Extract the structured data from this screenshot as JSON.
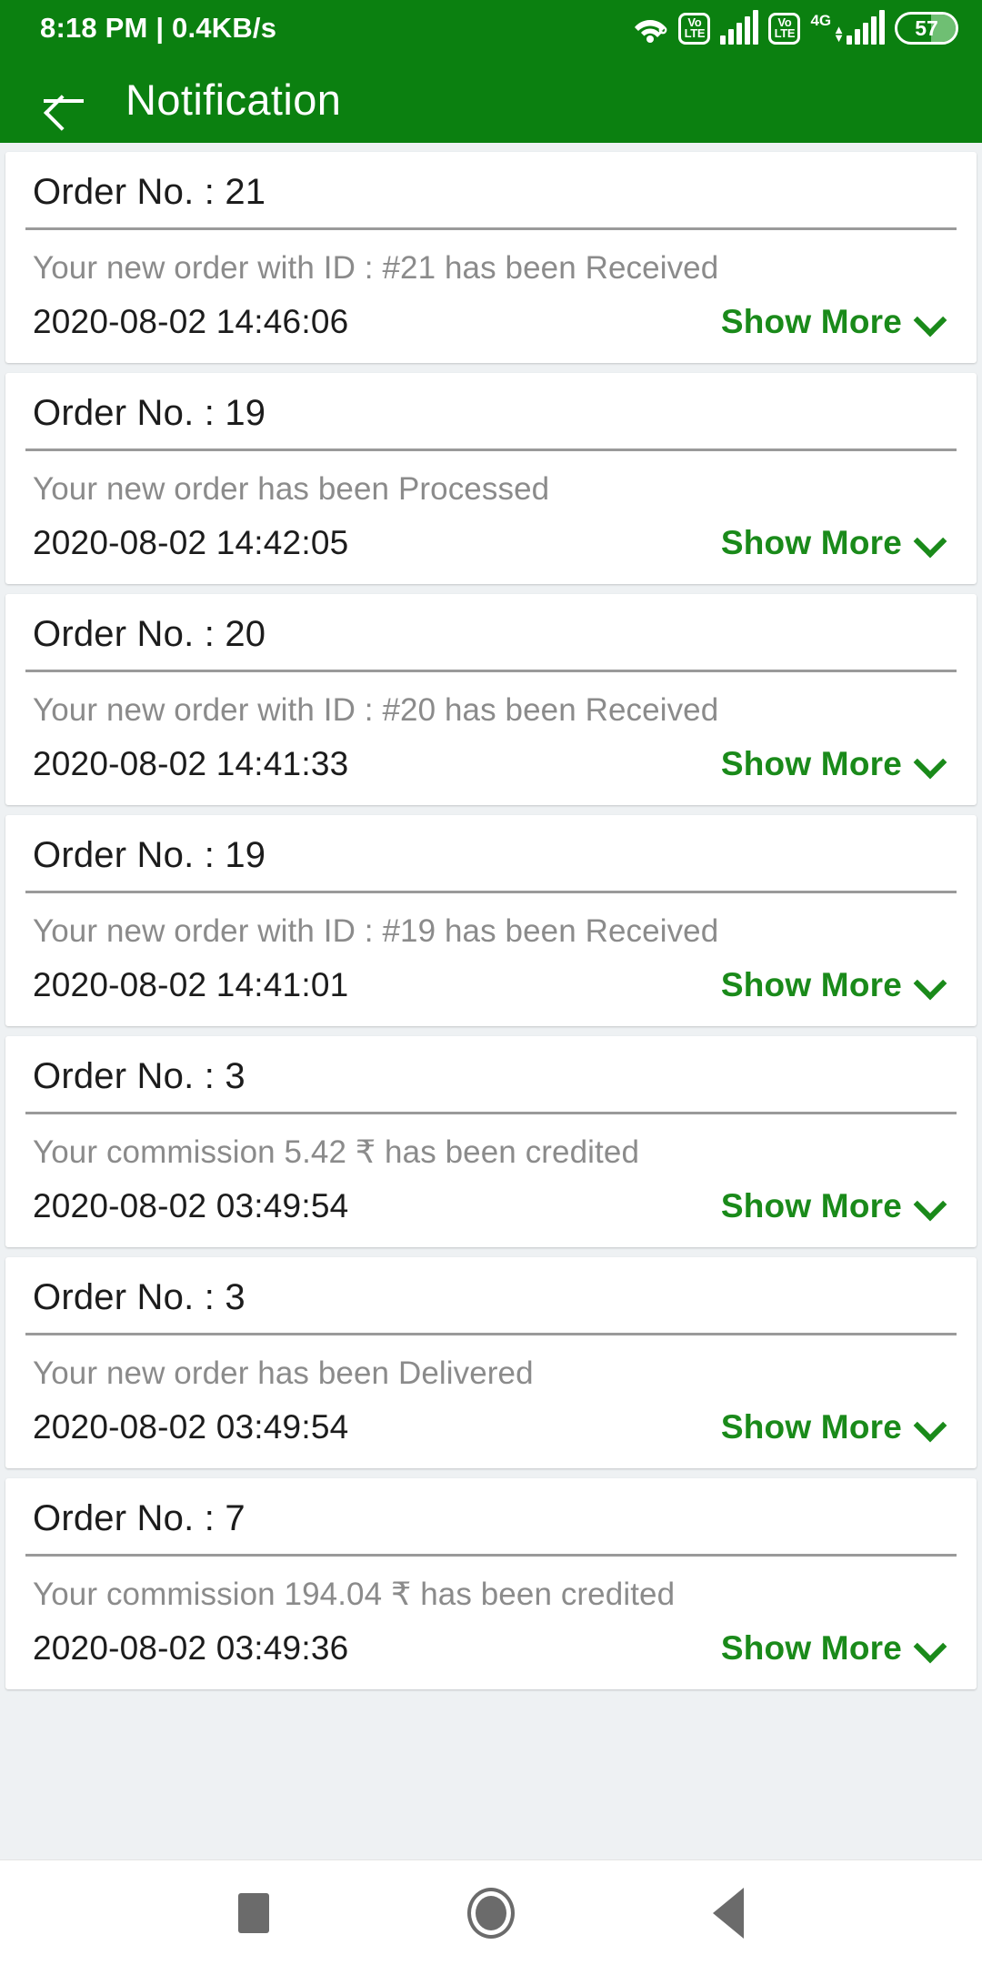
{
  "status_bar": {
    "time_and_speed": "8:18 PM | 0.4KB/s",
    "wifi_icon": "wifi-icon",
    "volte_1": {
      "top": "Vo",
      "bottom": "LTE"
    },
    "volte_2": {
      "top": "Vo",
      "bottom": "LTE"
    },
    "network_type": "4G",
    "battery_level": "57"
  },
  "app_bar": {
    "back_icon": "back-arrow-icon",
    "title": "Notification"
  },
  "notifications": [
    {
      "title": "Order No. : 21",
      "description": "Your new order with ID : #21  has been Received",
      "timestamp": "2020-08-02 14:46:06",
      "show_more_label": "Show More"
    },
    {
      "title": "Order No. : 19",
      "description": "Your new order has been Processed",
      "timestamp": "2020-08-02 14:42:05",
      "show_more_label": "Show More"
    },
    {
      "title": "Order No. : 20",
      "description": "Your new order with ID : #20  has been Received",
      "timestamp": "2020-08-02 14:41:33",
      "show_more_label": "Show More"
    },
    {
      "title": "Order No. : 19",
      "description": "Your new order with ID : #19  has been Received",
      "timestamp": "2020-08-02 14:41:01",
      "show_more_label": "Show More"
    },
    {
      "title": "Order No. : 3",
      "description": "Your commission 5.42 ₹ has been credited",
      "timestamp": "2020-08-02 03:49:54",
      "show_more_label": "Show More"
    },
    {
      "title": "Order No. : 3",
      "description": "Your new order has been Delivered",
      "timestamp": "2020-08-02 03:49:54",
      "show_more_label": "Show More"
    },
    {
      "title": "Order No. : 7",
      "description": "Your commission 194.04 ₹ has been credited",
      "timestamp": "2020-08-02 03:49:36",
      "show_more_label": "Show More"
    }
  ],
  "nav_bar": {
    "recents_icon": "square-recents-icon",
    "home_icon": "circle-home-icon",
    "back_icon": "triangle-back-icon"
  },
  "colors": {
    "header_green": "#0b8010",
    "link_green": "#1a8a1a",
    "page_background": "#eef1f3",
    "card_background": "#ffffff",
    "description_grey": "#8b8b8b"
  }
}
